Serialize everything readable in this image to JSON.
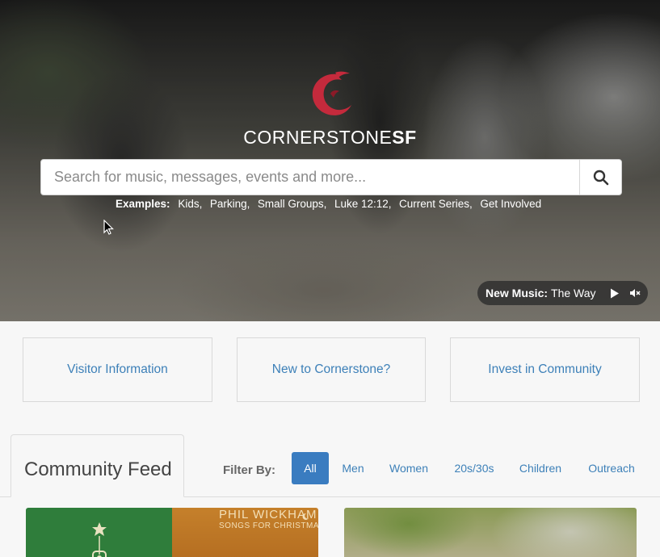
{
  "brand": {
    "name_regular": "CORNERSTONE",
    "name_bold": "SF",
    "logo_color": "#c42a3c"
  },
  "search": {
    "placeholder": "Search for music, messages, events and more...",
    "value": "",
    "icon": "search-icon"
  },
  "examples": {
    "label": "Examples:",
    "items": [
      "Kids,",
      "Parking,",
      "Small Groups,",
      "Luke 12:12,",
      "Current Series,",
      "Get Involved"
    ]
  },
  "music": {
    "label": "New Music:",
    "title": "The Way",
    "play_icon": "play-icon",
    "mute_icon": "mute-icon"
  },
  "quick_links": [
    {
      "label": "Visitor Information"
    },
    {
      "label": "New to Cornerstone?"
    },
    {
      "label": "Invest in Community"
    }
  ],
  "feed": {
    "title": "Community Feed",
    "filter_label": "Filter By:",
    "filters": [
      {
        "label": "All",
        "active": true
      },
      {
        "label": "Men",
        "active": false
      },
      {
        "label": "Women",
        "active": false
      },
      {
        "label": "20s/30s",
        "active": false
      },
      {
        "label": "Children",
        "active": false
      },
      {
        "label": "Outreach",
        "active": false
      }
    ],
    "cards": [
      {
        "album_artist": "PHIL WICKHAM",
        "album_title": "SONGS FOR CHRISTMAS"
      },
      {}
    ]
  },
  "colors": {
    "link": "#3d80b8",
    "active_filter": "#3a7cc0"
  }
}
